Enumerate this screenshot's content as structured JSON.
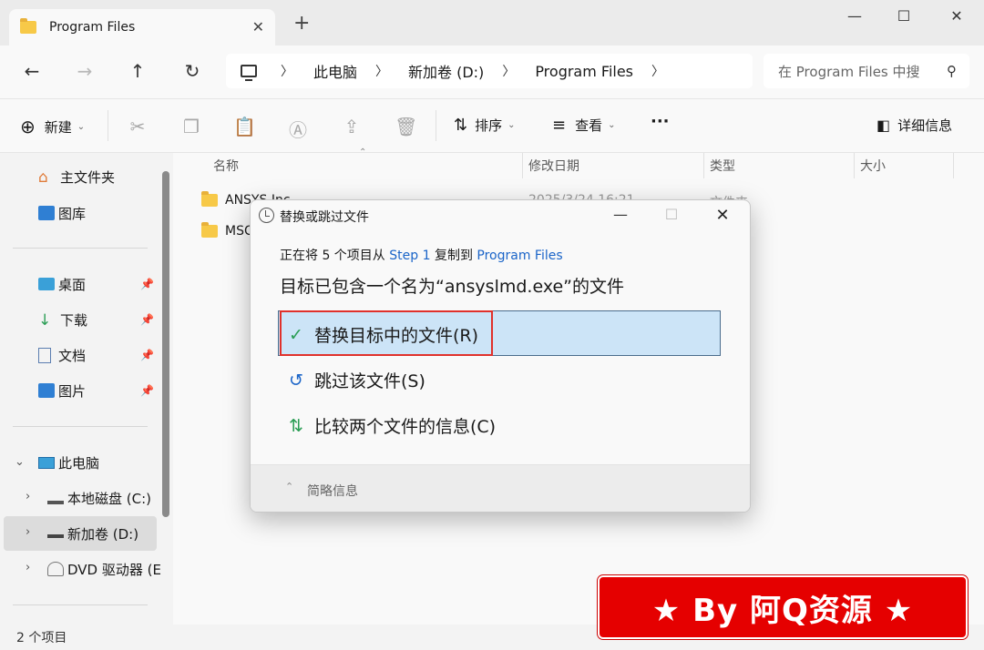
{
  "tab": {
    "title": "Program Files",
    "close": "✕",
    "new": "+"
  },
  "window": {
    "minimize": "—",
    "maximize": "☐",
    "close": "✕"
  },
  "nav": {
    "back": "←",
    "forward": "→",
    "up": "↑",
    "refresh": "↻"
  },
  "breadcrumb": [
    "此电脑",
    "新加卷 (D:)",
    "Program Files"
  ],
  "search": {
    "placeholder": "在 Program Files 中搜"
  },
  "toolbar": {
    "new_label": "新建",
    "sort_label": "排序",
    "view_label": "查看",
    "more_label": "···",
    "details_label": "详细信息"
  },
  "sidebar": {
    "home": "主文件夹",
    "gallery": "图库",
    "desktop": "桌面",
    "downloads": "下载",
    "documents": "文档",
    "pictures": "图片",
    "this_pc": "此电脑",
    "drive_c": "本地磁盘 (C:)",
    "drive_d": "新加卷 (D:)",
    "drive_dvd": "DVD 驱动器 (E"
  },
  "columns": {
    "name": "名称",
    "modified": "修改日期",
    "type": "类型",
    "size": "大小"
  },
  "files": [
    {
      "name": "ANSYS Inc",
      "modified": "2025/3/24 16:21",
      "type": "文件夹"
    },
    {
      "name": "MSC"
    }
  ],
  "status": {
    "count": "2 个项目"
  },
  "dialog": {
    "title": "替换或跳过文件",
    "line1_prefix": "正在将 5 个项目从 ",
    "line1_source": "Step 1",
    "line1_mid": " 复制到 ",
    "line1_dest": "Program Files",
    "line2": "目标已包含一个名为“ansyslmd.exe”的文件",
    "option_replace": "替换目标中的文件(R)",
    "option_skip": "跳过该文件(S)",
    "option_compare": "比较两个文件的信息(C)",
    "footer": "简略信息"
  },
  "banner": {
    "text": "★ By 阿Q资源 ★"
  },
  "colors": {
    "accent": "#1a64c8",
    "highlight_border": "#e0312b",
    "selection": "#cce4f7",
    "banner": "#e50000"
  }
}
